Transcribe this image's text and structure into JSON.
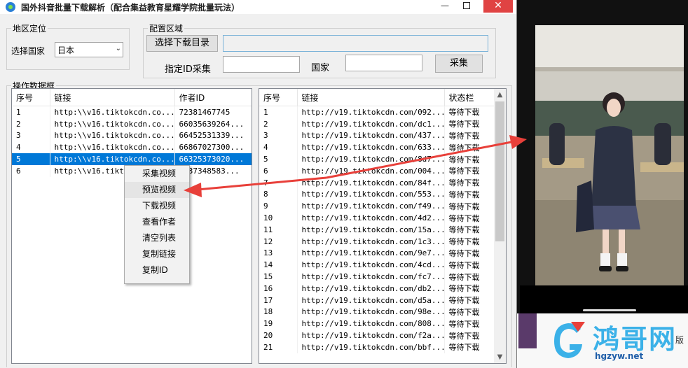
{
  "window": {
    "title": "国外抖音批量下载解析（配合集益教育星耀学院批量玩法）",
    "min_label": "—",
    "close_label": "✕"
  },
  "region": {
    "legend": "地区定位",
    "country_label": "选择国家",
    "country_value": "日本"
  },
  "config": {
    "legend": "配置区域",
    "select_dir_button": "选择下载目录",
    "id_collect_label": "指定ID采集",
    "country_label": "国家",
    "collect_button": "采集"
  },
  "data_frame": {
    "legend": "操作数据框"
  },
  "left_table": {
    "headers": [
      "序号",
      "链接",
      "作者ID"
    ],
    "rows": [
      [
        "1",
        "http:\\\\v16.tiktokcdn.co...",
        "72381467745"
      ],
      [
        "2",
        "http:\\\\v16.tiktokcdn.co...",
        "66035639264..."
      ],
      [
        "3",
        "http:\\\\v16.tiktokcdn.co...",
        "66452531339..."
      ],
      [
        "4",
        "http:\\\\v16.tiktokcdn.co...",
        "66867027300..."
      ],
      [
        "5",
        "http:\\\\v16.tiktokcdn.co...",
        "66325373020..."
      ],
      [
        "6",
        "http:\\\\v16.tiktok",
        "6337348583..."
      ]
    ],
    "selected_row": 5
  },
  "right_table": {
    "headers": [
      "序号",
      "链接",
      "状态栏"
    ],
    "rows": [
      [
        "1",
        "http://v19.tiktokcdn.com/092...",
        "等待下载"
      ],
      [
        "2",
        "http://v19.tiktokcdn.com/dc1...",
        "等待下载"
      ],
      [
        "3",
        "http://v19.tiktokcdn.com/437...",
        "等待下载"
      ],
      [
        "4",
        "http://v19.tiktokcdn.com/633...",
        "等待下载"
      ],
      [
        "5",
        "http://v19.tiktokcdn.com/8d7...",
        "等待下载"
      ],
      [
        "6",
        "http://v19.tiktokcdn.com/004...",
        "等待下载"
      ],
      [
        "7",
        "http://v19.tiktokcdn.com/84f...",
        "等待下载"
      ],
      [
        "8",
        "http://v19.tiktokcdn.com/553...",
        "等待下载"
      ],
      [
        "9",
        "http://v19.tiktokcdn.com/f49...",
        "等待下载"
      ],
      [
        "10",
        "http://v19.tiktokcdn.com/4d2...",
        "等待下载"
      ],
      [
        "11",
        "http://v19.tiktokcdn.com/15a...",
        "等待下载"
      ],
      [
        "12",
        "http://v19.tiktokcdn.com/1c3...",
        "等待下载"
      ],
      [
        "13",
        "http://v19.tiktokcdn.com/9e7...",
        "等待下载"
      ],
      [
        "14",
        "http://v19.tiktokcdn.com/4cd...",
        "等待下载"
      ],
      [
        "15",
        "http://v19.tiktokcdn.com/fc7...",
        "等待下载"
      ],
      [
        "16",
        "http://v19.tiktokcdn.com/db2...",
        "等待下载"
      ],
      [
        "17",
        "http://v19.tiktokcdn.com/d5a...",
        "等待下载"
      ],
      [
        "18",
        "http://v19.tiktokcdn.com/98e...",
        "等待下载"
      ],
      [
        "19",
        "http://v19.tiktokcdn.com/808...",
        "等待下载"
      ],
      [
        "20",
        "http://v19.tiktokcdn.com/f2a...",
        "等待下载"
      ],
      [
        "21",
        "http://v19.tiktokcdn.com/bbf...",
        "等待下载"
      ]
    ]
  },
  "context_menu": {
    "items": [
      "采集视频",
      "预览视频",
      "下载视频",
      "查看作者",
      "清空列表",
      "复制链接",
      "复制ID"
    ],
    "highlighted": 1
  },
  "watermark": {
    "brand_cn": "鸿哥网",
    "url": "hgzyw.net",
    "edge_text": "版"
  },
  "colors": {
    "selection": "#0078d7",
    "arrow": "#e8403a",
    "brand_blue": "#3bb1e8"
  }
}
